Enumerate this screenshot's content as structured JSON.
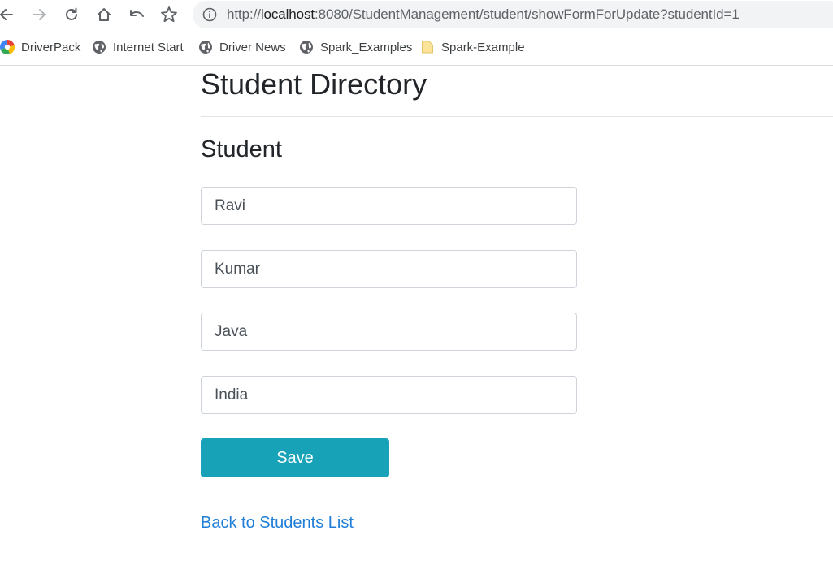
{
  "browser": {
    "url_prefix": "http://",
    "url_host": "localhost",
    "url_rest": ":8080/StudentManagement/student/showFormForUpdate?studentId=1",
    "icons": {
      "back": "arrow-left-icon",
      "forward": "arrow-right-icon",
      "reload": "reload-icon",
      "home": "home-icon",
      "undo": "undo-icon",
      "bookmark": "star-icon",
      "info": "info-icon"
    }
  },
  "bookmarks": {
    "items": [
      {
        "label": "DriverPack",
        "icon": "driverpack-icon"
      },
      {
        "label": "Internet Start",
        "icon": "globe-icon"
      },
      {
        "label": "Driver News",
        "icon": "globe-icon"
      },
      {
        "label": "Spark_Examples",
        "icon": "globe-icon"
      },
      {
        "label": "Spark-Example",
        "icon": "folder-icon"
      }
    ]
  },
  "page": {
    "title": "Student Directory",
    "section_title": "Student"
  },
  "form": {
    "first_name": "Ravi",
    "last_name": "Kumar",
    "course": "Java",
    "country": "India",
    "save_label": "Save"
  },
  "footer": {
    "back_link": "Back to Students List"
  },
  "colors": {
    "save_button": "#17a2b8",
    "link": "#1f7ed8",
    "field_border": "#ced4da"
  }
}
